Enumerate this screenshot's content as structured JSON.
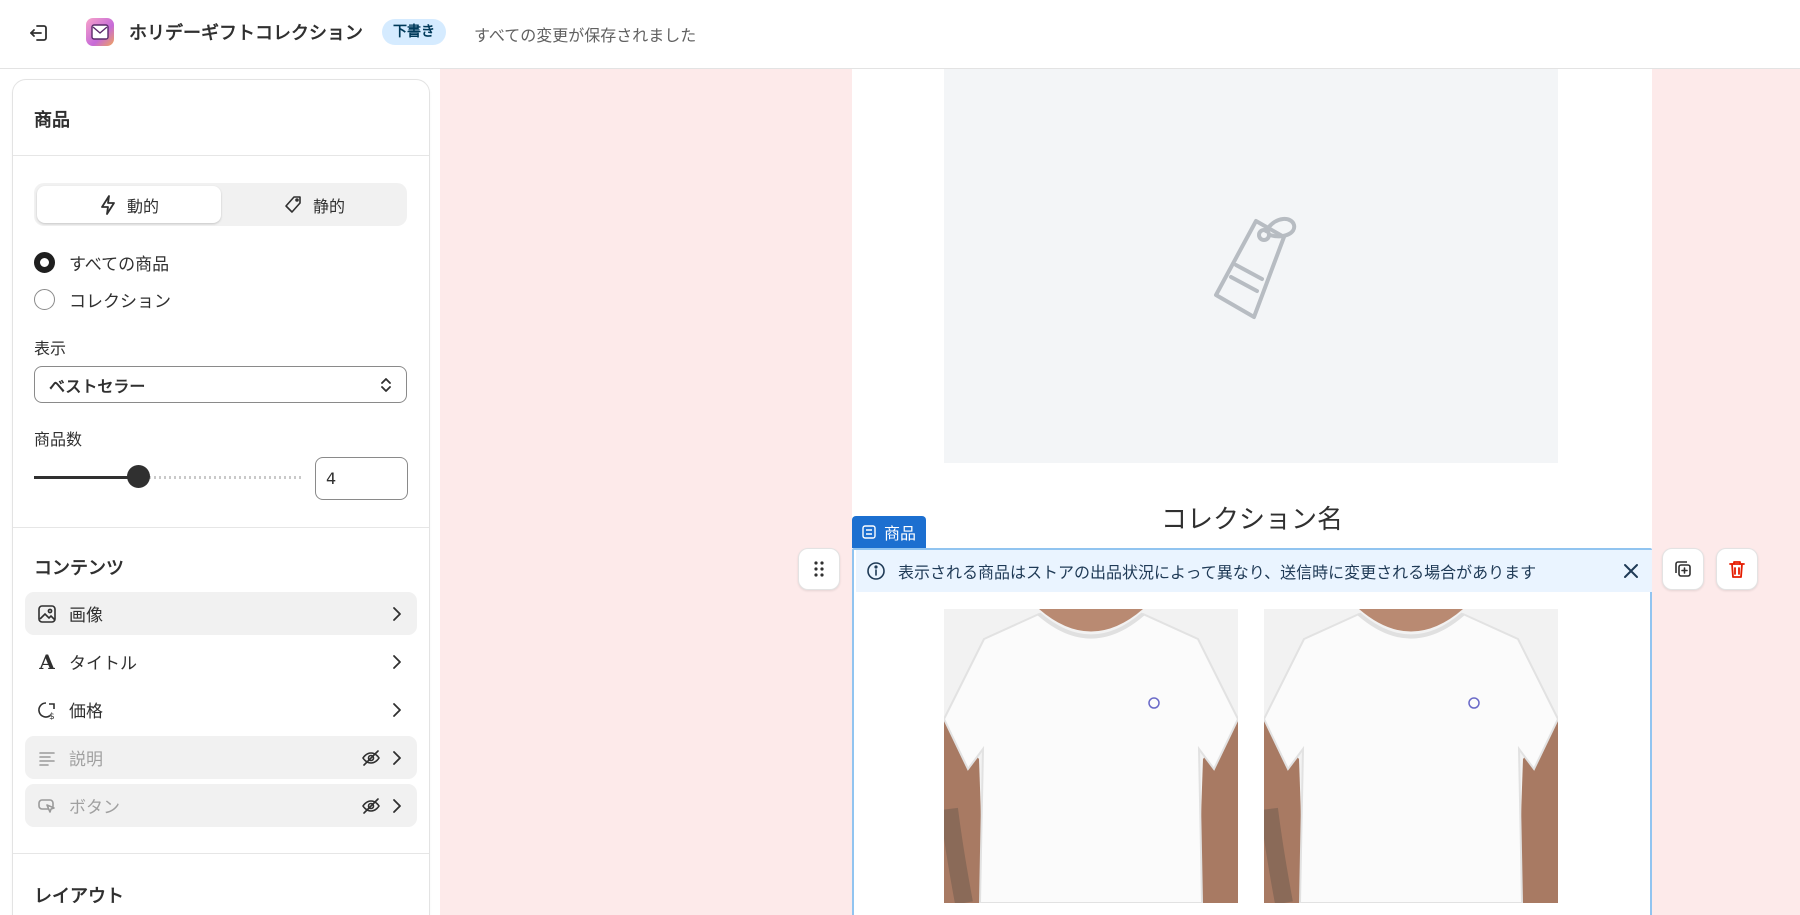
{
  "header": {
    "title": "ホリデーギフトコレクション",
    "status_badge": "下書き",
    "save_status": "すべての変更が保存されました"
  },
  "panel": {
    "title": "商品",
    "mode_tabs": [
      {
        "label": "動的",
        "icon": "lightning-icon",
        "selected": true
      },
      {
        "label": "静的",
        "icon": "tag-icon",
        "selected": false
      }
    ],
    "source_options": [
      {
        "label": "すべての商品",
        "checked": true
      },
      {
        "label": "コレクション",
        "checked": false
      }
    ],
    "display_label": "表示",
    "display_value": "ベストセラー",
    "count_label": "商品数",
    "count_value": "4",
    "content_title": "コンテンツ",
    "content_items": [
      {
        "label": "画像",
        "icon": "image-icon",
        "hidden": false
      },
      {
        "label": "タイトル",
        "icon": "text-icon",
        "hidden": false
      },
      {
        "label": "価格",
        "icon": "price-tag-icon",
        "hidden": false
      },
      {
        "label": "説明",
        "icon": "paragraph-icon",
        "hidden": true
      },
      {
        "label": "ボタン",
        "icon": "cursor-button-icon",
        "hidden": true
      }
    ],
    "layout_title": "レイアウト"
  },
  "canvas": {
    "collection_name": "コレクション名",
    "block_tag": "商品",
    "notice": "表示される商品はストアの出品状況によって異なり、送信時に変更される場合があります"
  },
  "colors": {
    "accent": "#1c6fd0",
    "canvas_bg": "#fdeaea",
    "badge_bg": "#d5ebff",
    "delete": "#e51c00"
  }
}
